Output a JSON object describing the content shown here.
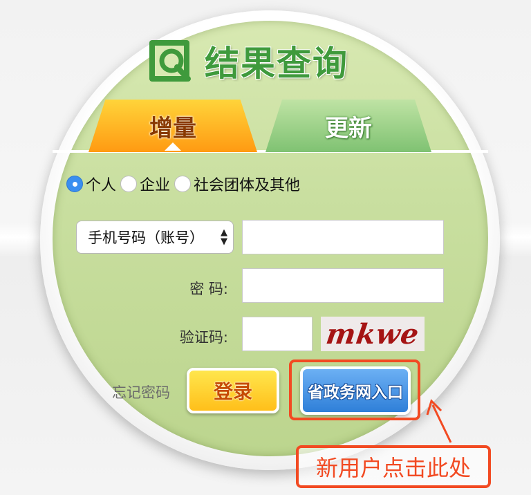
{
  "header": {
    "title": "结果查询"
  },
  "tabs": [
    {
      "label": "增量",
      "active": true
    },
    {
      "label": "更新",
      "active": false
    }
  ],
  "user_type": {
    "options": [
      "个人",
      "企业",
      "社会团体及其他"
    ],
    "selected": "个人"
  },
  "form": {
    "account_select_value": "手机号码（账号）",
    "account_value": "",
    "password_label": "密 码:",
    "password_value": "",
    "captcha_label": "验证码:",
    "captcha_value": "",
    "captcha_text": "mkwe"
  },
  "actions": {
    "forgot_label": "忘记密码",
    "login_label": "登录",
    "gov_portal_label": "省政务网入口"
  },
  "annotation": {
    "text": "新用户点击此处"
  },
  "colors": {
    "brand_green": "#3f9a3c",
    "tab_active": "#ff9a12",
    "highlight_red": "#f24a22",
    "button_blue": "#2f7fd8"
  },
  "icons": [
    "result-query-logo",
    "radio-icon",
    "sort-arrows-icon",
    "pointer-arrow"
  ]
}
